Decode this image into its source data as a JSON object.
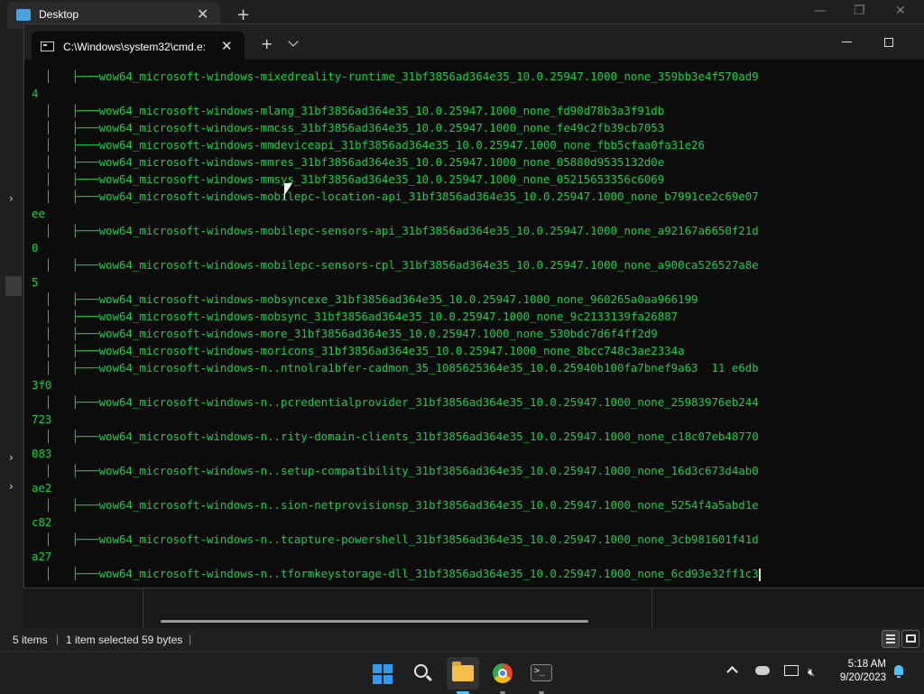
{
  "explorer": {
    "tab_title": "Desktop",
    "tab_close": "✕",
    "new_tab": "+",
    "window_controls": {
      "minimize": "—",
      "maximize": "❐",
      "close": "✕"
    },
    "status": {
      "items": "5 items",
      "selected": "1 item selected",
      "size": "59 bytes",
      "separator": "|"
    }
  },
  "terminal": {
    "tab_title": "C:\\Windows\\system32\\cmd.e:",
    "tab_close": "✕",
    "new_tab": "+",
    "lines": [
      "  │   ├───wow64_microsoft-windows-mixedreality-runtime_31bf3856ad364e35_10.0.25947.1000_none_359bb3e4f570ad9",
      "4",
      "  │   ├───wow64_microsoft-windows-mlang_31bf3856ad364e35_10.0.25947.1000_none_fd90d78b3a3f91db",
      "  │   ├───wow64_microsoft-windows-mmcss_31bf3856ad364e35_10.0.25947.1000_none_fe49c2fb39cb7053",
      "  │   ├───wow64_microsoft-windows-mmdeviceapi_31bf3856ad364e35_10.0.25947.1000_none_fbb5cfaa0fa31e26",
      "  │   ├───wow64_microsoft-windows-mmres_31bf3856ad364e35_10.0.25947.1000_none_05880d9535132d0e",
      "  │   ├───wow64_microsoft-windows-mmsys_31bf3856ad364e35_10.0.25947.1000_none_05215653356c6069",
      "  │   ├───wow64_microsoft-windows-mobilepc-location-api_31bf3856ad364e35_10.0.25947.1000_none_b7991ce2c69e07",
      "ee",
      "  │   ├───wow64_microsoft-windows-mobilepc-sensors-api_31bf3856ad364e35_10.0.25947.1000_none_a92167a6650f21d",
      "0",
      "  │   ├───wow64_microsoft-windows-mobilepc-sensors-cpl_31bf3856ad364e35_10.0.25947.1000_none_a900ca526527a8e",
      "5",
      "  │   ├───wow64_microsoft-windows-mobsyncexe_31bf3856ad364e35_10.0.25947.1000_none_960265a0aa966199",
      "  │   ├───wow64_microsoft-windows-mobsync_31bf3856ad364e35_10.0.25947.1000_none_9c2133139fa26887",
      "  │   ├───wow64_microsoft-windows-more_31bf3856ad364e35_10.0.25947.1000_none_530bdc7d6f4ff2d9",
      "  │   ├───wow64_microsoft-windows-moricons_31bf3856ad364e35_10.0.25947.1000_none_8bcc748c3ae2334a",
      "  │   ├───wow64_microsoft-windows-n..ntnolra1bfer-cadmon_35_1085625364e35_10.0.25940b100fa7bnef9a63  11 e6db",
      "3f0",
      "  │   ├───wow64_microsoft-windows-n..pcredentialprovider_31bf3856ad364e35_10.0.25947.1000_none_25983976eb244",
      "723",
      "  │   ├───wow64_microsoft-windows-n..rity-domain-clients_31bf3856ad364e35_10.0.25947.1000_none_c18c07eb48770",
      "083",
      "  │   ├───wow64_microsoft-windows-n..setup-compatibility_31bf3856ad364e35_10.0.25947.1000_none_16d3c673d4ab0",
      "ae2",
      "  │   ├───wow64_microsoft-windows-n..sion-netprovisionsp_31bf3856ad364e35_10.0.25947.1000_none_5254f4a5abd1e",
      "c82",
      "  │   ├───wow64_microsoft-windows-n..tcapture-powershell_31bf3856ad364e35_10.0.25947.1000_none_3cb981601f41d",
      "a27",
      "  │   ├───wow64_microsoft-windows-n..tformkeystorage-dll_31bf3856ad364e35_10.0.25947.1000_none_6cd93e32ff1c3"
    ],
    "text_color": "#13d04a"
  },
  "taskbar": {
    "clock_time": "5:18 AM",
    "clock_date": "9/20/2023",
    "apps": [
      "start-icon",
      "search-icon",
      "file-explorer-icon",
      "chrome-icon",
      "terminal-icon"
    ],
    "accent": "#2e9bf0"
  }
}
